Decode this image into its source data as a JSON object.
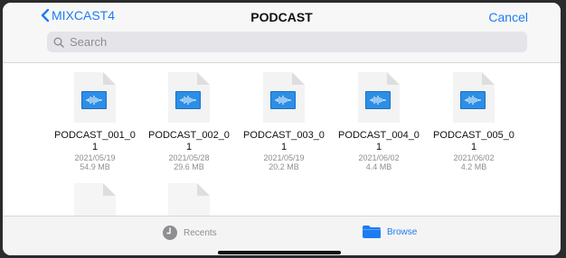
{
  "header": {
    "back_label": "MIXCAST4",
    "title": "PODCAST",
    "cancel_label": "Cancel"
  },
  "search": {
    "placeholder": "Search"
  },
  "files": [
    {
      "name_line1": "PODCAST_001_0",
      "name_line2": "1",
      "date": "2021/05/19",
      "size": "54.9 MB"
    },
    {
      "name_line1": "PODCAST_002_0",
      "name_line2": "1",
      "date": "2021/05/28",
      "size": "29.6 MB"
    },
    {
      "name_line1": "PODCAST_003_0",
      "name_line2": "1",
      "date": "2021/05/19",
      "size": "20.2 MB"
    },
    {
      "name_line1": "PODCAST_004_0",
      "name_line2": "1",
      "date": "2021/06/02",
      "size": "4.4 MB"
    },
    {
      "name_line1": "PODCAST_005_0",
      "name_line2": "1",
      "date": "2021/06/02",
      "size": "4.2 MB"
    }
  ],
  "tabbar": {
    "recents_label": "Recents",
    "browse_label": "Browse",
    "active_tab": "Browse"
  },
  "colors": {
    "accent": "#1e7cf2",
    "file_icon": "#2c8ee6"
  },
  "icons": {
    "back": "chevron-left-icon",
    "search": "search-icon",
    "file": "audio-file-icon",
    "recents": "clock-icon",
    "browse": "folder-icon"
  }
}
